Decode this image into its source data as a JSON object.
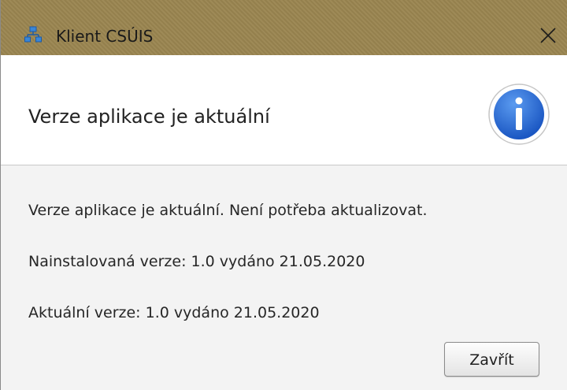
{
  "window": {
    "title": "Klient CSÚIS",
    "close_icon": "close-x-icon",
    "app_icon": "network-icon"
  },
  "header": {
    "text": "Verze aplikace je aktuální",
    "icon": "info-icon",
    "icon_color": "#1f5fc9"
  },
  "content": {
    "message": "Verze aplikace je aktuální. Není potřeba aktualizovat.",
    "installed_version": "Nainstalovaná verze: 1.0 vydáno 21.05.2020",
    "current_version": "Aktuální verze: 1.0 vydáno 21.05.2020"
  },
  "buttons": {
    "close_label": "Zavřít"
  },
  "colors": {
    "titlebar": "#9a8550",
    "content_bg": "#f3f3f3"
  }
}
